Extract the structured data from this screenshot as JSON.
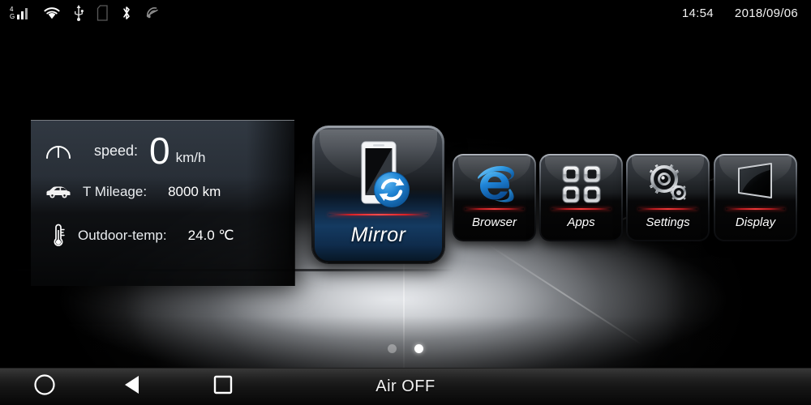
{
  "statusbar": {
    "icons": [
      {
        "name": "signal-4g-icon",
        "label": "4G"
      },
      {
        "name": "wifi-icon",
        "label": "wifi"
      },
      {
        "name": "usb-icon",
        "label": "usb"
      },
      {
        "name": "sd-card-icon",
        "label": "sd-card"
      },
      {
        "name": "bluetooth-icon",
        "label": "bluetooth"
      },
      {
        "name": "wireless-off-icon",
        "label": "wireless-off"
      }
    ],
    "time": "14:54",
    "date": "2018/09/06"
  },
  "info_panel": {
    "speed": {
      "label": "speed:",
      "value": "0",
      "unit": "km/h",
      "icon": "speedometer-icon"
    },
    "mileage": {
      "label": "T Mileage:",
      "value": "8000 km",
      "icon": "car-icon"
    },
    "outdoor_temp": {
      "label": "Outdoor-temp:",
      "value": "24.0 ℃",
      "icon": "thermometer-icon"
    }
  },
  "tiles": {
    "featured": {
      "label": "Mirror",
      "icon": "phone-mirror-sync-icon"
    },
    "items": [
      {
        "label": "Browser",
        "icon": "internet-explorer-icon"
      },
      {
        "label": "Apps",
        "icon": "apps-grid-icon"
      },
      {
        "label": "Settings",
        "icon": "gears-icon"
      },
      {
        "label": "Display",
        "icon": "display-screen-icon"
      }
    ]
  },
  "pager": {
    "total": 2,
    "active_index": 1
  },
  "navbar": {
    "home": "home-circle-icon",
    "back": "back-triangle-icon",
    "recent": "recents-square-icon",
    "air_status": "Air OFF"
  },
  "colors": {
    "accent_red": "#d81f24",
    "accent_blue": "#1a78c8",
    "background": "#000000",
    "text": "#ffffff"
  }
}
